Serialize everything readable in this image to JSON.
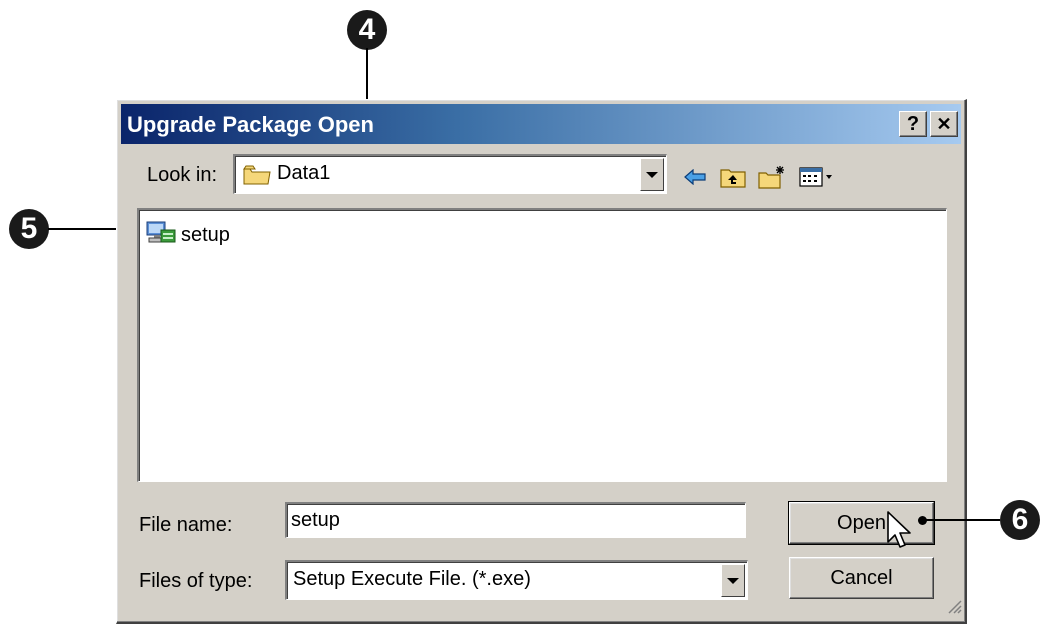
{
  "callouts": [
    "4",
    "5",
    "6"
  ],
  "dialog": {
    "title": "Upgrade Package Open",
    "help_button": "?",
    "close_button": "✕",
    "look_in": {
      "label": "Look in:",
      "value": "Data1"
    },
    "toolbar": {
      "icons": [
        "back-icon",
        "up-folder-icon",
        "new-folder-icon",
        "view-menu-icon"
      ]
    },
    "files": [
      {
        "name": "setup",
        "icon": "setup-exe-icon"
      }
    ],
    "file_name": {
      "label": "File name:",
      "value": "setup"
    },
    "files_of_type": {
      "label": "Files of type:",
      "value": "Setup Execute File. (*.exe)"
    },
    "buttons": {
      "open": "Open",
      "cancel": "Cancel"
    }
  },
  "colors": {
    "titlebar_start": "#0a246a",
    "titlebar_end": "#a6caf0",
    "face": "#d4d0c8"
  }
}
